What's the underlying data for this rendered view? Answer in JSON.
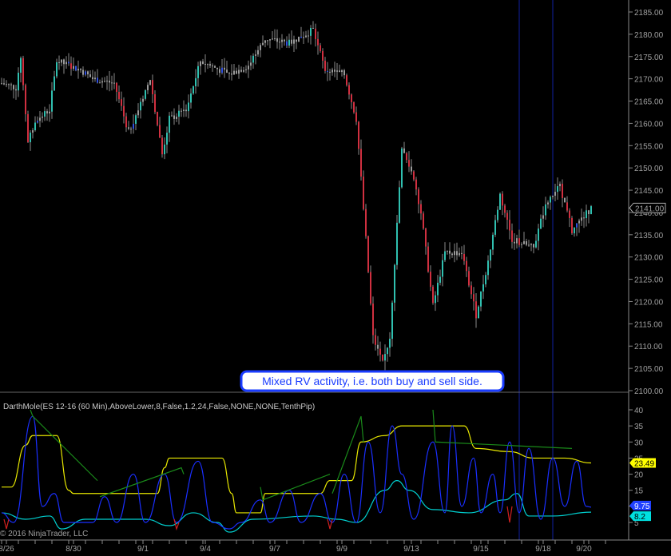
{
  "chart_data": [
    {
      "type": "candlestick",
      "title": "ES 12-16 (60 Min)",
      "ylim": [
        2098,
        2187
      ],
      "y_ticks": [
        "2185.00",
        "2180.00",
        "2175.00",
        "2170.00",
        "2165.00",
        "2160.00",
        "2155.00",
        "2150.00",
        "2145.00",
        "2140.00",
        "2135.00",
        "2130.00",
        "2125.00",
        "2120.00",
        "2115.00",
        "2110.00",
        "2105.00",
        "2100.00"
      ],
      "y_tick_values": [
        2185,
        2180,
        2175,
        2170,
        2165,
        2160,
        2155,
        2150,
        2145,
        2140,
        2135,
        2130,
        2125,
        2120,
        2115,
        2110,
        2105,
        2100
      ],
      "last_price_label": "2141.00",
      "last_price": 2141,
      "price_path": [
        [
          0,
          2169
        ],
        [
          6,
          2168
        ],
        [
          8,
          2175
        ],
        [
          11,
          2156
        ],
        [
          15,
          2161
        ],
        [
          20,
          2163
        ],
        [
          23,
          2174
        ],
        [
          33,
          2172
        ],
        [
          38,
          2170
        ],
        [
          47,
          2169
        ],
        [
          53,
          2158
        ],
        [
          62,
          2170
        ],
        [
          67,
          2153
        ],
        [
          70,
          2161
        ],
        [
          77,
          2163
        ],
        [
          83,
          2174
        ],
        [
          95,
          2171
        ],
        [
          103,
          2173
        ],
        [
          110,
          2179
        ],
        [
          120,
          2178
        ],
        [
          130,
          2181
        ],
        [
          135,
          2172
        ],
        [
          143,
          2171
        ],
        [
          148,
          2161
        ],
        [
          152,
          2134
        ],
        [
          155,
          2112
        ],
        [
          159,
          2106
        ],
        [
          162,
          2112
        ],
        [
          167,
          2154
        ],
        [
          172,
          2148
        ],
        [
          175,
          2140
        ],
        [
          180,
          2119
        ],
        [
          185,
          2131
        ],
        [
          192,
          2131
        ],
        [
          198,
          2117
        ],
        [
          203,
          2129
        ],
        [
          208,
          2144
        ],
        [
          213,
          2134
        ],
        [
          222,
          2132
        ],
        [
          227,
          2142
        ],
        [
          233,
          2146
        ],
        [
          238,
          2136
        ],
        [
          246,
          2141
        ]
      ],
      "annotation": "Mixed RV activity, i.e. both buy and sell side.",
      "vertical_markers_bar": [
        216,
        230
      ]
    },
    {
      "type": "line",
      "title": "DarthMole(ES 12-16 (60 Min),AboveLower,8,False,1.2,24,False,NONE,NONE,TenthPip)",
      "ylim": [
        1,
        44
      ],
      "y_ticks": [
        "40",
        "35",
        "30",
        "25",
        "20",
        "15",
        "10",
        "5"
      ],
      "y_tick_values": [
        40,
        35,
        30,
        25,
        20,
        15,
        10,
        5
      ],
      "series": [
        {
          "name": "yellow",
          "color": "#e8e800",
          "points": [
            [
              0,
              16
            ],
            [
              4,
              16
            ],
            [
              10,
              29
            ],
            [
              13,
              32
            ],
            [
              23,
              32
            ],
            [
              28,
              15
            ],
            [
              30,
              14
            ],
            [
              65,
              14
            ],
            [
              68,
              22
            ],
            [
              70,
              25
            ],
            [
              92,
              25
            ],
            [
              96,
              14
            ],
            [
              98,
              8
            ],
            [
              108,
              8
            ],
            [
              110,
              14
            ],
            [
              133,
              14
            ],
            [
              137,
              18
            ],
            [
              146,
              18
            ],
            [
              150,
              30
            ],
            [
              160,
              32
            ],
            [
              167,
              35
            ],
            [
              193,
              35
            ],
            [
              198,
              28
            ],
            [
              212,
              27
            ],
            [
              222,
              25
            ],
            [
              235,
              25
            ],
            [
              246,
              23.49
            ]
          ]
        },
        {
          "name": "cyan",
          "color": "#00d0d0",
          "points": [
            [
              0,
              8
            ],
            [
              10,
              6
            ],
            [
              20,
              7
            ],
            [
              25,
              3
            ],
            [
              35,
              6
            ],
            [
              60,
              6
            ],
            [
              70,
              4
            ],
            [
              80,
              8
            ],
            [
              90,
              5
            ],
            [
              95,
              2
            ],
            [
              105,
              6
            ],
            [
              130,
              7
            ],
            [
              140,
              6
            ],
            [
              148,
              5
            ],
            [
              160,
              15
            ],
            [
              165,
              18
            ],
            [
              170,
              15
            ],
            [
              180,
              9
            ],
            [
              195,
              8
            ],
            [
              210,
              12
            ],
            [
              215,
              14
            ],
            [
              220,
              7
            ],
            [
              230,
              7
            ],
            [
              246,
              8.2
            ]
          ]
        },
        {
          "name": "blue",
          "color": "#1a2fff",
          "points": [
            [
              0,
              8
            ],
            [
              5,
              5
            ],
            [
              13,
              38
            ],
            [
              17,
              10
            ],
            [
              22,
              14
            ],
            [
              26,
              5
            ],
            [
              33,
              5
            ],
            [
              38,
              5
            ],
            [
              43,
              13
            ],
            [
              48,
              5
            ],
            [
              55,
              20
            ],
            [
              60,
              5
            ],
            [
              68,
              20
            ],
            [
              73,
              5
            ],
            [
              82,
              24
            ],
            [
              88,
              5
            ],
            [
              95,
              3
            ],
            [
              100,
              5
            ],
            [
              108,
              12
            ],
            [
              112,
              5
            ],
            [
              120,
              15
            ],
            [
              125,
              5
            ],
            [
              133,
              14
            ],
            [
              138,
              5
            ],
            [
              143,
              20
            ],
            [
              148,
              5
            ],
            [
              153,
              30
            ],
            [
              158,
              8
            ],
            [
              163,
              35
            ],
            [
              167,
              20
            ],
            [
              172,
              6
            ],
            [
              180,
              30
            ],
            [
              185,
              8
            ],
            [
              188,
              35
            ],
            [
              192,
              10
            ],
            [
              197,
              25
            ],
            [
              200,
              8
            ],
            [
              205,
              20
            ],
            [
              208,
              8
            ],
            [
              212,
              30
            ],
            [
              216,
              8
            ],
            [
              220,
              28
            ],
            [
              225,
              6
            ],
            [
              230,
              25
            ],
            [
              235,
              10
            ],
            [
              240,
              24
            ],
            [
              244,
              10
            ],
            [
              246,
              9.75
            ]
          ]
        },
        {
          "name": "green",
          "color": "#1a8a1a",
          "points": [
            [
              12,
              40
            ],
            [
              13,
              38
            ],
            [
              40,
              18
            ],
            [
              41,
              13
            ],
            [
              75,
              22
            ],
            [
              76,
              20
            ],
            [
              108,
              16
            ],
            [
              109,
              12
            ],
            [
              137,
              20
            ],
            [
              138,
              14
            ],
            [
              150,
              38
            ],
            [
              151,
              30
            ],
            [
              180,
              40
            ],
            [
              181,
              30
            ],
            [
              238,
              28
            ],
            [
              239,
              24
            ]
          ]
        },
        {
          "name": "red",
          "color": "#d02020",
          "points": [
            [
              1,
              6
            ],
            [
              2,
              3
            ],
            [
              3,
              6
            ],
            [
              72,
              6
            ],
            [
              73,
              3
            ],
            [
              74,
              5
            ],
            [
              136,
              6
            ],
            [
              137,
              3
            ],
            [
              138,
              6
            ],
            [
              211,
              10
            ],
            [
              212,
              5
            ],
            [
              213,
              10
            ]
          ]
        }
      ],
      "value_labels": [
        {
          "text": "23.49",
          "value": 23.49,
          "color": "#ffff00"
        },
        {
          "text": "9.75",
          "value": 9.75,
          "color": "#2040ff"
        },
        {
          "text": "8.2",
          "value": 8.2,
          "color": "#00e0e0"
        }
      ]
    }
  ],
  "x_axis": {
    "labels": [
      "8/26",
      "8/30",
      "9/1",
      "9/4",
      "9/7",
      "9/9",
      "9/13",
      "9/15",
      "9/18",
      "9/20"
    ],
    "label_bars": [
      2,
      30,
      59,
      85,
      114,
      142,
      171,
      200,
      226,
      243
    ]
  },
  "copyright": "© 2016 NinjaTrader, LLC"
}
